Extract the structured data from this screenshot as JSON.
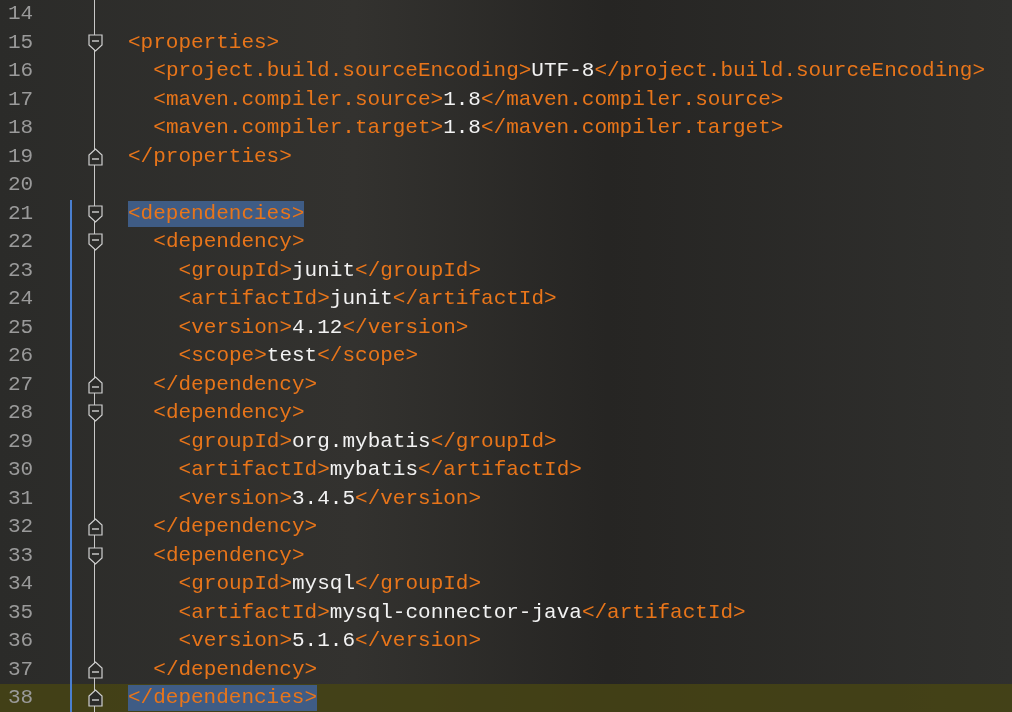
{
  "nodes": [
    {
      "kind": "blank",
      "line": "14",
      "changed": false,
      "current": false
    },
    {
      "kind": "block",
      "matched": false,
      "start": {
        "line": "15",
        "tag": "<properties>",
        "changed": false,
        "current": false
      },
      "children": [
        {
          "kind": "leaf",
          "line": "16",
          "open_tag": "<project.build.sourceEncoding>",
          "value": "UTF-8",
          "close_tag": "</project.build.sourceEncoding>",
          "changed": false,
          "current": false
        },
        {
          "kind": "leaf",
          "line": "17",
          "open_tag": "<maven.compiler.source>",
          "value": "1.8",
          "close_tag": "</maven.compiler.source>",
          "changed": false,
          "current": false
        },
        {
          "kind": "leaf",
          "line": "18",
          "open_tag": "<maven.compiler.target>",
          "value": "1.8",
          "close_tag": "</maven.compiler.target>",
          "changed": false,
          "current": false
        }
      ],
      "end": {
        "line": "19",
        "tag": "</properties>",
        "changed": false,
        "current": false
      }
    },
    {
      "kind": "blank",
      "line": "20",
      "changed": false,
      "current": false
    },
    {
      "kind": "block",
      "matched": true,
      "start": {
        "line": "21",
        "tag": "<dependencies>",
        "changed": true,
        "current": false
      },
      "children": [
        {
          "kind": "block",
          "matched": false,
          "start": {
            "line": "22",
            "tag": "<dependency>",
            "changed": true,
            "current": false
          },
          "children": [
            {
              "kind": "leaf",
              "line": "23",
              "open_tag": "<groupId>",
              "value": "junit",
              "close_tag": "</groupId>",
              "changed": true,
              "current": false
            },
            {
              "kind": "leaf",
              "line": "24",
              "open_tag": "<artifactId>",
              "value": "junit",
              "close_tag": "</artifactId>",
              "changed": true,
              "current": false
            },
            {
              "kind": "leaf",
              "line": "25",
              "open_tag": "<version>",
              "value": "4.12",
              "close_tag": "</version>",
              "changed": true,
              "current": false
            },
            {
              "kind": "leaf",
              "line": "26",
              "open_tag": "<scope>",
              "value": "test",
              "close_tag": "</scope>",
              "changed": true,
              "current": false
            }
          ],
          "end": {
            "line": "27",
            "tag": "</dependency>",
            "changed": true,
            "current": false
          }
        },
        {
          "kind": "block",
          "matched": false,
          "start": {
            "line": "28",
            "tag": "<dependency>",
            "changed": true,
            "current": false
          },
          "children": [
            {
              "kind": "leaf",
              "line": "29",
              "open_tag": "<groupId>",
              "value": "org.mybatis",
              "close_tag": "</groupId>",
              "changed": true,
              "current": false
            },
            {
              "kind": "leaf",
              "line": "30",
              "open_tag": "<artifactId>",
              "value": "mybatis",
              "close_tag": "</artifactId>",
              "changed": true,
              "current": false
            },
            {
              "kind": "leaf",
              "line": "31",
              "open_tag": "<version>",
              "value": "3.4.5",
              "close_tag": "</version>",
              "changed": true,
              "current": false
            }
          ],
          "end": {
            "line": "32",
            "tag": "</dependency>",
            "changed": true,
            "current": false
          }
        },
        {
          "kind": "block",
          "matched": false,
          "start": {
            "line": "33",
            "tag": "<dependency>",
            "changed": true,
            "current": false
          },
          "children": [
            {
              "kind": "leaf",
              "line": "34",
              "open_tag": "<groupId>",
              "value": "mysql",
              "close_tag": "</groupId>",
              "changed": true,
              "current": false
            },
            {
              "kind": "leaf",
              "line": "35",
              "open_tag": "<artifactId>",
              "value": "mysql-connector-java",
              "close_tag": "</artifactId>",
              "changed": true,
              "current": false
            },
            {
              "kind": "leaf",
              "line": "36",
              "open_tag": "<version>",
              "value": "5.1.6",
              "close_tag": "</version>",
              "changed": true,
              "current": false
            }
          ],
          "end": {
            "line": "37",
            "tag": "</dependency>",
            "changed": true,
            "current": false
          }
        }
      ],
      "end": {
        "line": "38",
        "tag": "</dependencies>",
        "changed": true,
        "current": true
      }
    }
  ]
}
